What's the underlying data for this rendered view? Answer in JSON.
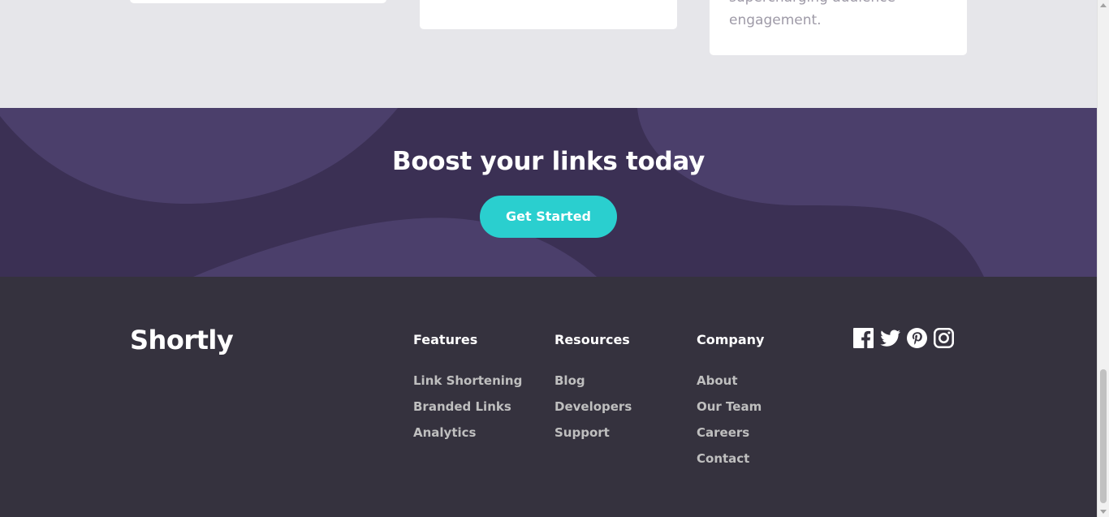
{
  "stats": {
    "card3_text": "supercharging audience engagement."
  },
  "boost": {
    "title": "Boost your links today",
    "button_label": "Get Started"
  },
  "footer": {
    "logo": "Shortly",
    "columns": [
      {
        "heading": "Features",
        "links": [
          "Link Shortening",
          "Branded Links",
          "Analytics"
        ]
      },
      {
        "heading": "Resources",
        "links": [
          "Blog",
          "Developers",
          "Support"
        ]
      },
      {
        "heading": "Company",
        "links": [
          "About",
          "Our Team",
          "Careers",
          "Contact"
        ]
      }
    ],
    "socials": [
      "facebook-icon",
      "twitter-icon",
      "pinterest-icon",
      "instagram-icon"
    ]
  },
  "colors": {
    "cyan": "#2acfcf",
    "dark_violet": "#3b3054",
    "footer_bg": "#35323e",
    "stats_bg": "#e6e6ea"
  }
}
